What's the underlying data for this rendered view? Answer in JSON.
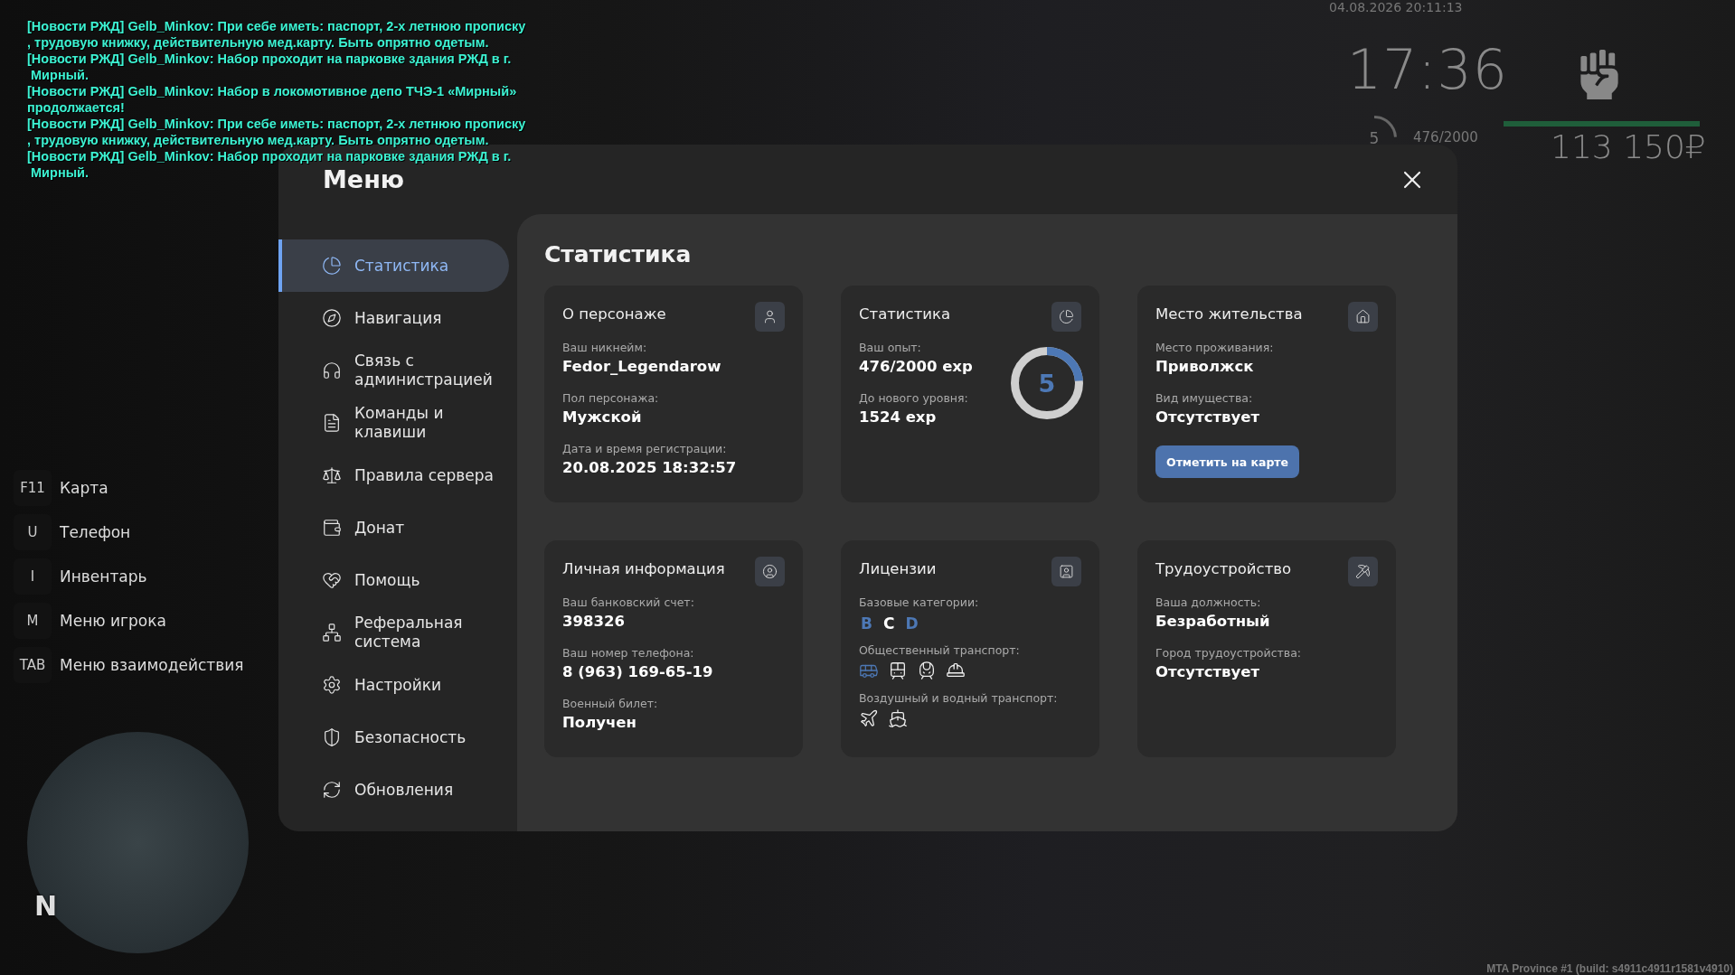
{
  "chat": [
    "[Новости РЖД] Gelb_Minkov: При себе иметь: паспорт, 2-х летнюю прописку",
    ", трудовую книжку, действительную мед.карту. Быть опрятно одетым.",
    "[Новости РЖД] Gelb_Minkov: Набор проходит на парковке здания РЖД в г.",
    " Мирный.",
    "[Новости РЖД] Gelb_Minkov: Набор в локомотивное депо ТЧЭ-1 «Мирный»",
    "продолжается!",
    "[Новости РЖД] Gelb_Minkov: При себе иметь: паспорт, 2-х летнюю прописку",
    ", трудовую книжку, действительную мед.карту. Быть опрятно одетым.",
    "[Новости РЖД] Gelb_Minkov: Набор проходит на парковке здания РЖД в г.",
    " Мирный."
  ],
  "hud": {
    "date": "04.08.2026 20:11:13",
    "clock": "17:36",
    "level": "5",
    "exp": "476/2000",
    "exp_ring": {
      "level": 0.238
    },
    "health_bar": {
      "level": 1
    },
    "money": "113 150₽"
  },
  "hotkeys": [
    {
      "key": "F11",
      "label": "Карта"
    },
    {
      "key": "U",
      "label": "Телефон"
    },
    {
      "key": "I",
      "label": "Инвентарь"
    },
    {
      "key": "M",
      "label": "Меню игрока"
    },
    {
      "key": "TAB",
      "label": "Меню взаимодействия"
    }
  ],
  "minimap": {
    "north": "N"
  },
  "menu": {
    "title": "Меню",
    "sidebar": [
      {
        "label": "Статистика",
        "selected": true
      },
      {
        "label": "Навигация",
        "selected": false
      },
      {
        "label": "Связь с администрацией",
        "selected": false
      },
      {
        "label": "Команды и клавиши",
        "selected": false
      },
      {
        "label": "Правила сервера",
        "selected": false
      },
      {
        "label": "Донат",
        "selected": false
      },
      {
        "label": "Помощь",
        "selected": false
      },
      {
        "label": "Реферальная система",
        "selected": false
      },
      {
        "label": "Настройки",
        "selected": false
      },
      {
        "label": "Безопасность",
        "selected": false
      },
      {
        "label": "Обновления",
        "selected": false
      }
    ],
    "heading": "Статистика",
    "cards": [
      {
        "title": "О персонаже",
        "fields": [
          {
            "label": "Ваш никнейм:",
            "value": "Fedor_Legendarow"
          },
          {
            "label": "Пол персонажа:",
            "value": "Мужской"
          },
          {
            "label": "Дата и время регистрации:",
            "value": "20.08.2025 18:32:57"
          }
        ]
      },
      {
        "title": "Статистика",
        "fields": [
          {
            "label": "Ваш опыт:",
            "value": "476/2000 exp"
          },
          {
            "label": "До нового уровня:",
            "value": "1524 exp"
          }
        ],
        "ring": {
          "text": "5",
          "level": 0.238
        }
      },
      {
        "title": "Место жительства",
        "fields": [
          {
            "label": "Место проживания:",
            "value": "Приволжск"
          },
          {
            "label": "Вид имущества:",
            "value": "Отсутствует"
          }
        ],
        "button": "Отметить на карте"
      },
      {
        "title": "Личная информация",
        "fields": [
          {
            "label": "Ваш банковский счет:",
            "value": "398326"
          },
          {
            "label": "Ваш номер телефона:",
            "value": "8 (963) 169-65-19"
          },
          {
            "label": "Военный билет:",
            "value": "Получен"
          }
        ]
      },
      {
        "title": "Лицензии",
        "categories_label": "Базовые категории:",
        "categories": [
          {
            "text": "B",
            "obtained": true
          },
          {
            "text": "C",
            "obtained": false
          },
          {
            "text": "D",
            "obtained": true
          }
        ],
        "sections": [
          {
            "label": "Общественный транспорт:",
            "items": [
              {
                "kind": "trolleybus",
                "obtained": true
              },
              {
                "kind": "tram",
                "obtained": false
              },
              {
                "kind": "train",
                "obtained": false
              },
              {
                "kind": "cap",
                "obtained": false
              }
            ]
          },
          {
            "label": "Воздушный и водный транспорт:",
            "items": [
              {
                "kind": "plane",
                "obtained": false
              },
              {
                "kind": "ship",
                "obtained": false
              }
            ]
          }
        ]
      },
      {
        "title": "Трудоустройство",
        "fields": [
          {
            "label": "Ваша должность:",
            "value": "Безработный"
          },
          {
            "label": "Город трудоустройства:",
            "value": "Отсутствует"
          }
        ]
      }
    ]
  },
  "build": "MTA Province #1 (build: s4911c4911r1581v4910)"
}
